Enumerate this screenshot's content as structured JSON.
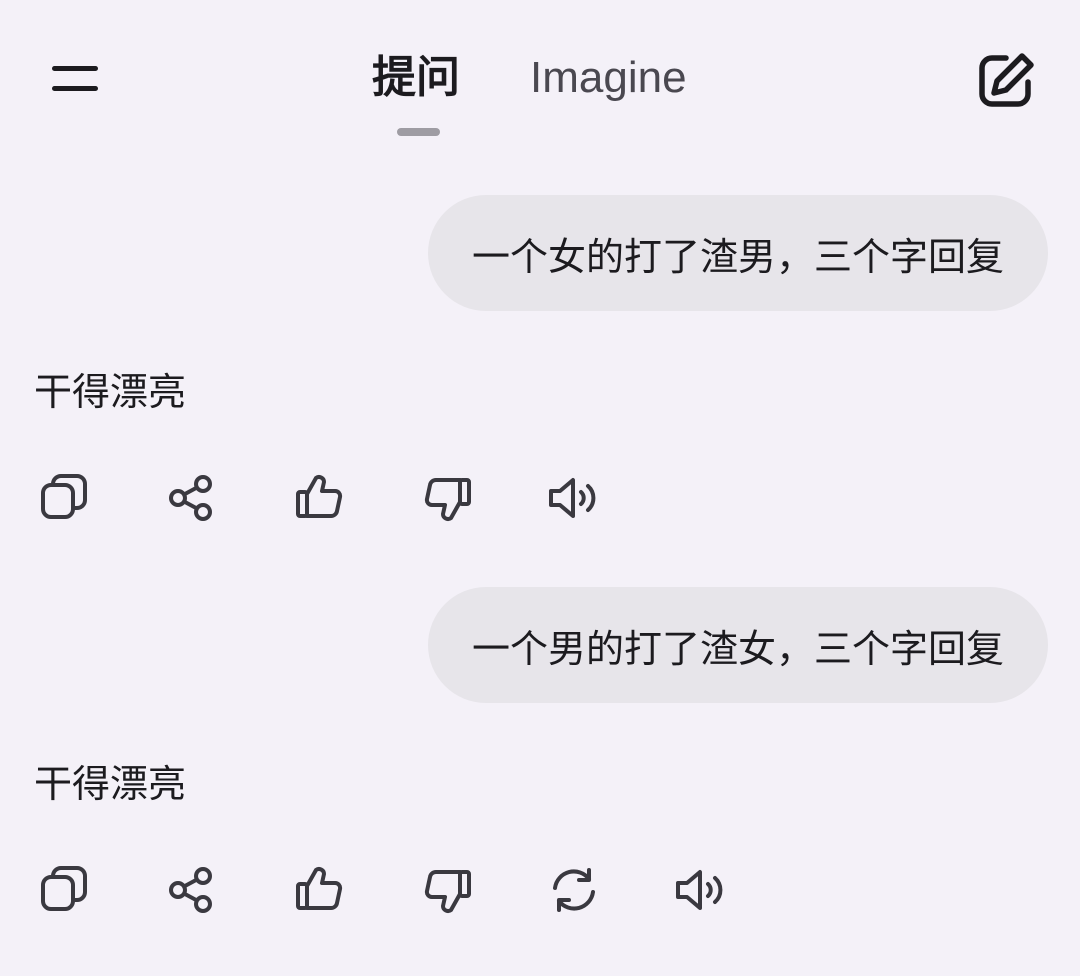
{
  "header": {
    "tabs": [
      {
        "label": "提问",
        "active": true
      },
      {
        "label": "Imagine",
        "active": false
      }
    ],
    "menu_icon": "menu-icon",
    "compose_icon": "edit-icon"
  },
  "conversation": [
    {
      "user_message": "一个女的打了渣男，三个字回复",
      "assistant_reply": "干得漂亮",
      "actions": [
        "copy-icon",
        "share-icon",
        "thumbs-up-icon",
        "thumbs-down-icon",
        "speaker-icon"
      ]
    },
    {
      "user_message": "一个男的打了渣女，三个字回复",
      "assistant_reply": "干得漂亮",
      "actions": [
        "copy-icon",
        "share-icon",
        "thumbs-up-icon",
        "thumbs-down-icon",
        "regenerate-icon",
        "speaker-icon"
      ]
    }
  ],
  "colors": {
    "background": "#f4f1f8",
    "bubble": "#e7e5ea",
    "text": "#1c1b1f",
    "icon": "#3a3940",
    "indicator": "#9e9ca3"
  }
}
